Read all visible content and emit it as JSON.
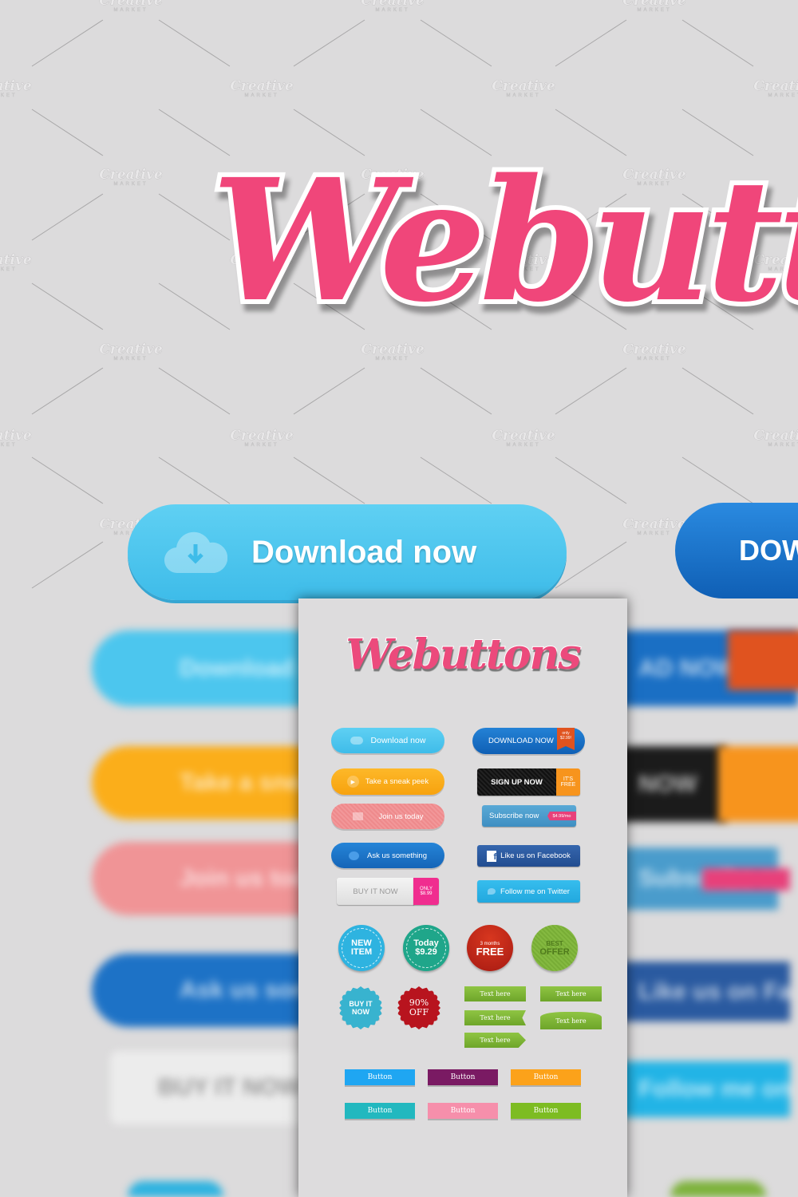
{
  "watermark": {
    "brand": "Creative",
    "sub": "MARKET"
  },
  "hero": {
    "title": "Webutto",
    "download_label": "Download now",
    "download2_label": "DOW"
  },
  "background_blurred": {
    "left": [
      "Download now",
      "Take a sneak peek",
      "Join us today",
      "Ask us something",
      "BUY IT NOW"
    ],
    "right": [
      "AD NOW",
      "NOW",
      "Subscribe now",
      "Like us on Facebook",
      "Follow me on Twitter"
    ]
  },
  "panel": {
    "title": "Webuttons",
    "pills": [
      {
        "label": "Download now",
        "color": "#4cc3ee",
        "icon": "cloud-download-icon"
      },
      {
        "label": "Take a sneak peek",
        "color": "#fba918",
        "icon": "play-icon"
      },
      {
        "label": "Join us today",
        "color": "#f08d8f",
        "icon": "card-icon"
      },
      {
        "label": "Ask us something",
        "color": "#1d72c6",
        "icon": "speech-bubble-icon"
      }
    ],
    "download_now": {
      "label": "DOWNLOAD NOW",
      "ribbon": "only $2.99!"
    },
    "sign_up": {
      "label": "SIGN UP NOW",
      "tag": "IT'S FREE"
    },
    "subscribe": {
      "label": "Subscribe now",
      "tag": "$4.99/mo"
    },
    "facebook": {
      "label": "Like us on Facebook",
      "icon": "facebook-icon"
    },
    "buy": {
      "label": "BUY IT NOW",
      "tag": "ONLY $8.99"
    },
    "twitter": {
      "label": "Follow me on Twitter",
      "icon": "twitter-bird-icon"
    },
    "badges": [
      {
        "line1": "NEW",
        "line2": "ITEM",
        "color": "#2eb3e0"
      },
      {
        "line1": "Today",
        "line2": "$9.29",
        "color": "#1fa68a"
      },
      {
        "line1": "3 months",
        "line2": "FREE",
        "color": "#c3251a"
      },
      {
        "line1": "BEST",
        "line2": "OFFER",
        "color": "#7db23b"
      }
    ],
    "seals": [
      {
        "line1": "BUY IT",
        "line2": "NOW",
        "color": "#38b3cf"
      },
      {
        "line1": "90%",
        "line2": "OFF",
        "color": "#b8141e"
      }
    ],
    "ribbons": [
      "Text here",
      "Text here",
      "Text here",
      "Text here",
      "Text here"
    ],
    "buttons": [
      {
        "label": "Button",
        "color": "#1fa6f2"
      },
      {
        "label": "Button",
        "color": "#7a1a63"
      },
      {
        "label": "Button",
        "color": "#fca21a"
      },
      {
        "label": "Button",
        "color": "#22b8bf"
      },
      {
        "label": "Button",
        "color": "#f68fab"
      },
      {
        "label": "Button",
        "color": "#7dbc22"
      }
    ]
  }
}
